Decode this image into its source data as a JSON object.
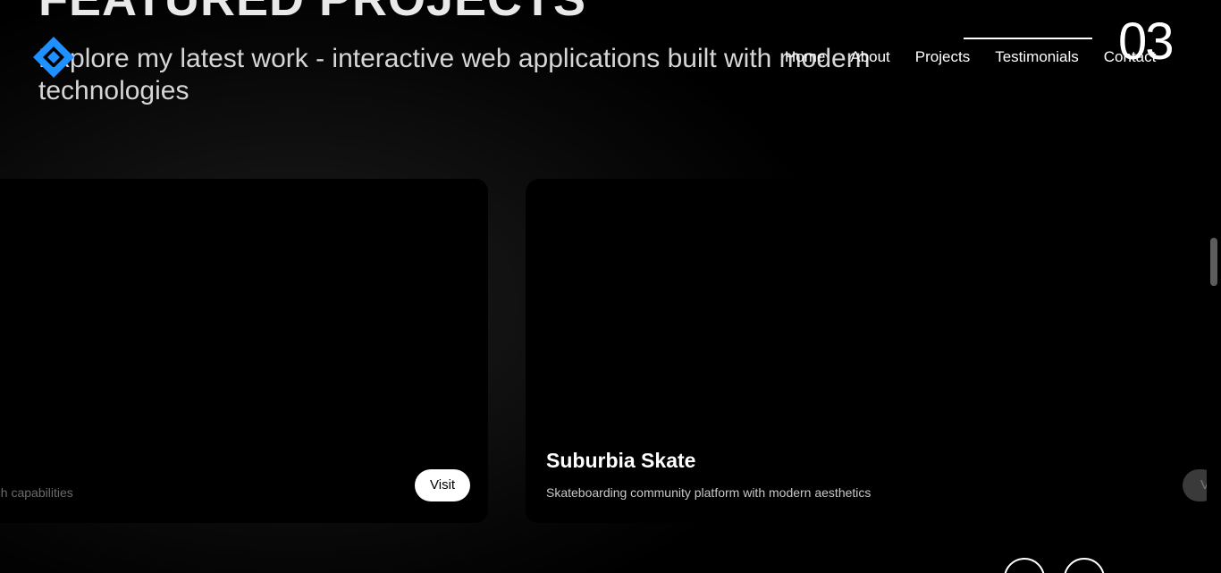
{
  "section": {
    "title": "FEATURED PROJECTS",
    "subtitle": "Explore my latest work - interactive web applications built with modern technologies"
  },
  "nav": {
    "items": [
      "Home",
      "About",
      "Projects",
      "Testimonials",
      "Contact"
    ]
  },
  "slider": {
    "counter": "03"
  },
  "cards": [
    {
      "description": "ech capabilities",
      "visit_label": "Visit"
    },
    {
      "title": "Suburbia Skate",
      "description": "Skateboarding community platform with modern aesthetics",
      "visit_label": "Vi"
    }
  ],
  "colors": {
    "background": "#000000",
    "logo_blue": "#1e90ff",
    "text": "#ffffff"
  },
  "icons": {
    "logo": "diamond-logo-icon",
    "prev": "arrow-left-icon",
    "next": "arrow-right-icon"
  }
}
